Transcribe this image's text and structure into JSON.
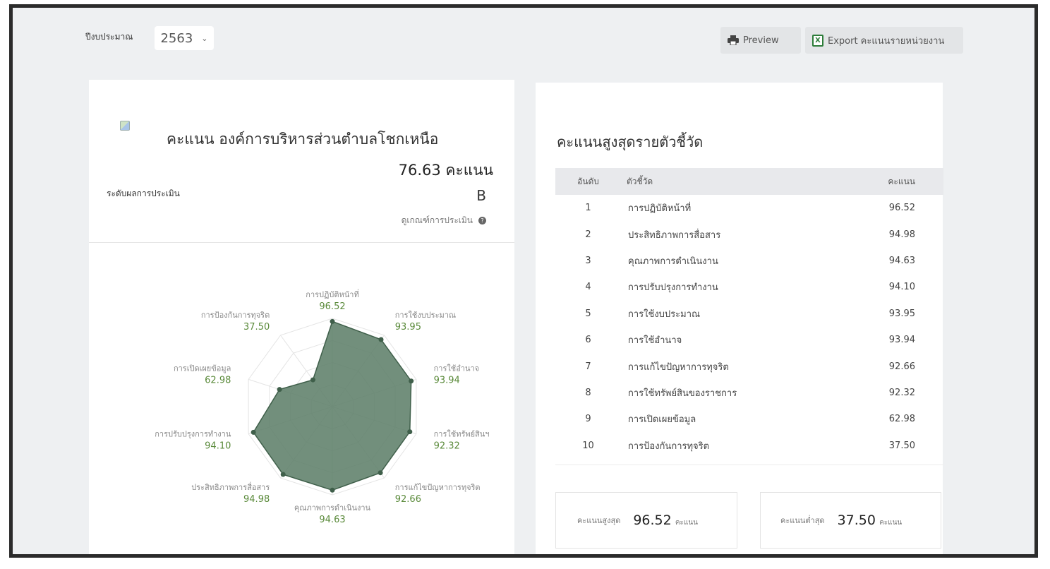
{
  "toolbar": {
    "year_label": "ปีงบประมาณ",
    "year_value": "2563",
    "preview_label": "Preview",
    "export_label": "Export คะแนนรายหน่วยงาน"
  },
  "score_card": {
    "title": "คะแนน องค์การบริหารส่วนตำบลโชกเหนือ",
    "total_score": "76.63 คะแนน",
    "level_label": "ระดับผลการประเมิน",
    "grade": "B",
    "criteria_link": "ดูเกณฑ์การประเมิน"
  },
  "radar": {
    "color_fill": "#5f7f6a",
    "color_value": "#5a8a3a",
    "max": 100,
    "axes": [
      {
        "label": "การปฏิบัติหน้าที่",
        "value": 96.52
      },
      {
        "label": "การใช้งบประมาณ",
        "value": 93.95
      },
      {
        "label": "การใช้อำนาจ",
        "value": 93.94
      },
      {
        "label": "การใช้ทรัพย์สินฯ",
        "value": 92.32
      },
      {
        "label": "การแก้ไขปัญหาการทุจริต",
        "value": 92.66
      },
      {
        "label": "คุณภาพการดำเนินงาน",
        "value": 94.63
      },
      {
        "label": "ประสิทธิภาพการสื่อสาร",
        "value": 94.98
      },
      {
        "label": "การปรับปรุงการทำงาน",
        "value": 94.1
      },
      {
        "label": "การเปิดเผยข้อมูล",
        "value": 62.98
      },
      {
        "label": "การป้องกันการทุจริต",
        "value": 37.5
      }
    ]
  },
  "top_table": {
    "title": "คะแนนสูงสุดรายตัวชี้วัด",
    "headers": {
      "rank": "อันดับ",
      "indicator": "ตัวชี้วัด",
      "score": "คะแนน"
    },
    "rows": [
      {
        "rank": "1",
        "name": "การปฏิบัติหน้าที่",
        "score": "96.52"
      },
      {
        "rank": "2",
        "name": "ประสิทธิภาพการสื่อสาร",
        "score": "94.98"
      },
      {
        "rank": "3",
        "name": "คุณภาพการดำเนินงาน",
        "score": "94.63"
      },
      {
        "rank": "4",
        "name": "การปรับปรุงการทำงาน",
        "score": "94.10"
      },
      {
        "rank": "5",
        "name": "การใช้งบประมาณ",
        "score": "93.95"
      },
      {
        "rank": "6",
        "name": "การใช้อำนาจ",
        "score": "93.94"
      },
      {
        "rank": "7",
        "name": "การแก้ไขปัญหาการทุจริต",
        "score": "92.66"
      },
      {
        "rank": "8",
        "name": "การใช้ทรัพย์สินของราชการ",
        "score": "92.32"
      },
      {
        "rank": "9",
        "name": "การเปิดเผยข้อมูล",
        "score": "62.98"
      },
      {
        "rank": "10",
        "name": "การป้องกันการทุจริต",
        "score": "37.50"
      }
    ]
  },
  "summary": {
    "max_label": "คะแนนสูงสุด",
    "max_value": "96.52",
    "min_label": "คะแนนต่ำสุด",
    "min_value": "37.50",
    "unit": "คะแนน"
  }
}
